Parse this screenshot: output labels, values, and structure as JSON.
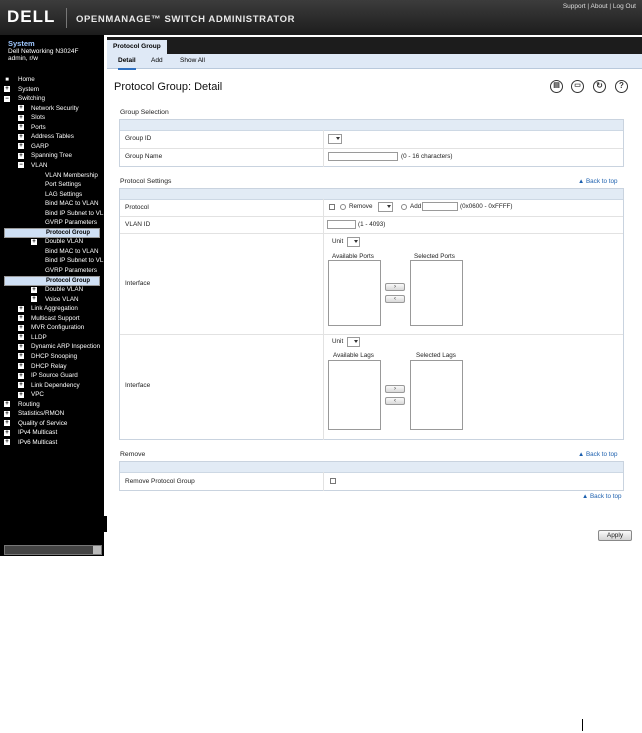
{
  "header": {
    "logo": "DELL",
    "app_title": "OPENMANAGE™ SWITCH ADMINISTRATOR",
    "links": [
      "Support",
      "About",
      "Log Out"
    ]
  },
  "system": {
    "title": "System",
    "device": "Dell Networking N3024F",
    "user": "admin, r/w"
  },
  "tree": [
    {
      "label": "Home",
      "level": 0,
      "icon": "home-icon"
    },
    {
      "label": "System",
      "level": 0,
      "icon": "plus"
    },
    {
      "label": "Switching",
      "level": 0,
      "icon": "minus"
    },
    {
      "label": "Network Security",
      "level": 1,
      "icon": "plus"
    },
    {
      "label": "Slots",
      "level": 1,
      "icon": "plus"
    },
    {
      "label": "Ports",
      "level": 1,
      "icon": "plus"
    },
    {
      "label": "Address Tables",
      "level": 1,
      "icon": "plus"
    },
    {
      "label": "GARP",
      "level": 1,
      "icon": "plus"
    },
    {
      "label": "Spanning Tree",
      "level": 1,
      "icon": "plus"
    },
    {
      "label": "VLAN",
      "level": 1,
      "icon": "minus"
    },
    {
      "label": "VLAN Membership",
      "level": 2,
      "icon": ""
    },
    {
      "label": "Port Settings",
      "level": 2,
      "icon": ""
    },
    {
      "label": "LAG Settings",
      "level": 2,
      "icon": ""
    },
    {
      "label": "Bind MAC to VLAN",
      "level": 2,
      "icon": ""
    },
    {
      "label": "Bind IP Subnet to VL",
      "level": 2,
      "icon": ""
    },
    {
      "label": "GVRP Parameters",
      "level": 2,
      "icon": ""
    },
    {
      "label": "Protocol Group",
      "level": 2,
      "icon": "",
      "selected": true
    },
    {
      "label": "Double VLAN",
      "level": 2,
      "icon": "plus"
    },
    {
      "label": "Bind MAC to VLAN",
      "level": 2,
      "icon": ""
    },
    {
      "label": "Bind IP Subnet to VL",
      "level": 2,
      "icon": ""
    },
    {
      "label": "GVRP Parameters",
      "level": 2,
      "icon": ""
    },
    {
      "label": "Protocol Group",
      "level": 2,
      "icon": "",
      "selected": true
    },
    {
      "label": "Double VLAN",
      "level": 2,
      "icon": "plus"
    },
    {
      "label": "Voice VLAN",
      "level": 2,
      "icon": "plus"
    },
    {
      "label": "Link Aggregation",
      "level": 1,
      "icon": "plus"
    },
    {
      "label": "Multicast Support",
      "level": 1,
      "icon": "plus"
    },
    {
      "label": "MVR Configuration",
      "level": 1,
      "icon": "plus"
    },
    {
      "label": "LLDP",
      "level": 1,
      "icon": "plus"
    },
    {
      "label": "Dynamic ARP Inspection",
      "level": 1,
      "icon": "plus"
    },
    {
      "label": "DHCP Snooping",
      "level": 1,
      "icon": "plus"
    },
    {
      "label": "DHCP Relay",
      "level": 1,
      "icon": "plus"
    },
    {
      "label": "IP Source Guard",
      "level": 1,
      "icon": "plus"
    },
    {
      "label": "Link Dependency",
      "level": 1,
      "icon": "plus"
    },
    {
      "label": "VPC",
      "level": 1,
      "icon": "plus"
    },
    {
      "label": "Routing",
      "level": 0,
      "icon": "plus"
    },
    {
      "label": "Statistics/RMON",
      "level": 0,
      "icon": "plus"
    },
    {
      "label": "Quality of Service",
      "level": 0,
      "icon": "plus"
    },
    {
      "label": "IPv4 Multicast",
      "level": 0,
      "icon": "plus"
    },
    {
      "label": "IPv6 Multicast",
      "level": 0,
      "icon": "plus"
    }
  ],
  "tab": {
    "label": "Protocol Group"
  },
  "subtabs": [
    "Detail",
    "Add",
    "Show All"
  ],
  "page_title": "Protocol Group: Detail",
  "toolbar_icons": [
    "save-icon",
    "print-icon",
    "refresh-icon",
    "help-icon"
  ],
  "group_selection": {
    "heading": "Group Selection",
    "group_id_label": "Group ID",
    "group_name_label": "Group Name",
    "group_name_hint": "(0 - 16 characters)"
  },
  "protocol_settings": {
    "heading": "Protocol Settings",
    "back_to_top": "▲ Back to top",
    "protocol_label": "Protocol",
    "remove_label": "Remove",
    "add_label": "Add",
    "protocol_hint": "(0x0600 - 0xFFFF)",
    "vlan_id_label": "VLAN ID",
    "vlan_hint": "(1 - 4093)",
    "interface_label": "Interface",
    "unit_label": "Unit",
    "available_ports": "Available Ports",
    "selected_ports": "Selected Ports",
    "interface_label_2": "Interface",
    "available_lags": "Available Lags",
    "selected_lags": "Selected Lags",
    "move_right": "›",
    "move_left": "‹"
  },
  "remove_section": {
    "heading": "Remove",
    "back_to_top": "▲ Back to top",
    "label": "Remove Protocol Group",
    "bottom_back_to_top": "▲ Back to top"
  },
  "apply_label": "Apply"
}
